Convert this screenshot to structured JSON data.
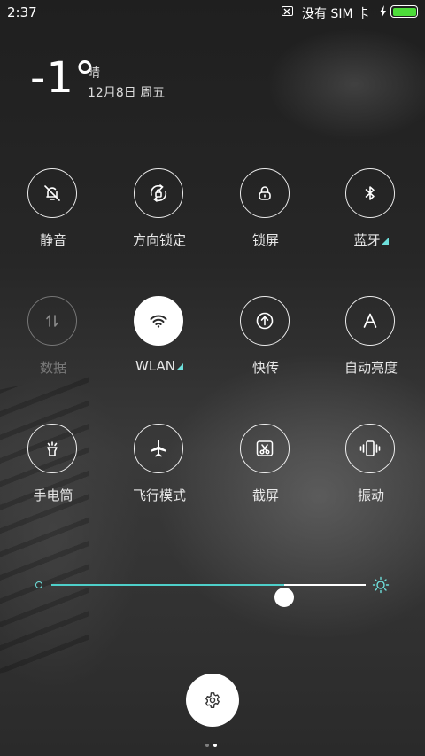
{
  "status_bar": {
    "time": "2:37",
    "sim_text": "没有 SIM 卡",
    "battery_percent": 100,
    "colors": {
      "battery": "#4ddc3a"
    }
  },
  "weather": {
    "temperature": "-1°",
    "condition": "晴",
    "date": "12月8日 周五"
  },
  "toggles": [
    {
      "label": "静音",
      "icon": "mute-bell-icon",
      "state": "off"
    },
    {
      "label": "方向锁定",
      "icon": "rotation-lock-icon",
      "state": "off"
    },
    {
      "label": "锁屏",
      "icon": "lock-icon",
      "state": "off"
    },
    {
      "label": "蓝牙",
      "icon": "bluetooth-icon",
      "state": "off",
      "has_expand": true
    },
    {
      "label": "数据",
      "icon": "mobile-data-icon",
      "state": "disabled"
    },
    {
      "label": "WLAN",
      "icon": "wifi-icon",
      "state": "on",
      "has_expand": true
    },
    {
      "label": "快传",
      "icon": "quick-transfer-icon",
      "state": "off"
    },
    {
      "label": "自动亮度",
      "icon": "auto-brightness-icon",
      "state": "off"
    },
    {
      "label": "手电筒",
      "icon": "flashlight-icon",
      "state": "off"
    },
    {
      "label": "飞行模式",
      "icon": "airplane-icon",
      "state": "off"
    },
    {
      "label": "截屏",
      "icon": "screenshot-icon",
      "state": "off"
    },
    {
      "label": "振动",
      "icon": "vibrate-icon",
      "state": "off"
    }
  ],
  "brightness": {
    "level": 0.74
  },
  "pager": {
    "page_count": 2,
    "active_page": 2
  },
  "colors": {
    "accent": "#4ecfc9",
    "expand_triangle": "#6ee0dc"
  }
}
